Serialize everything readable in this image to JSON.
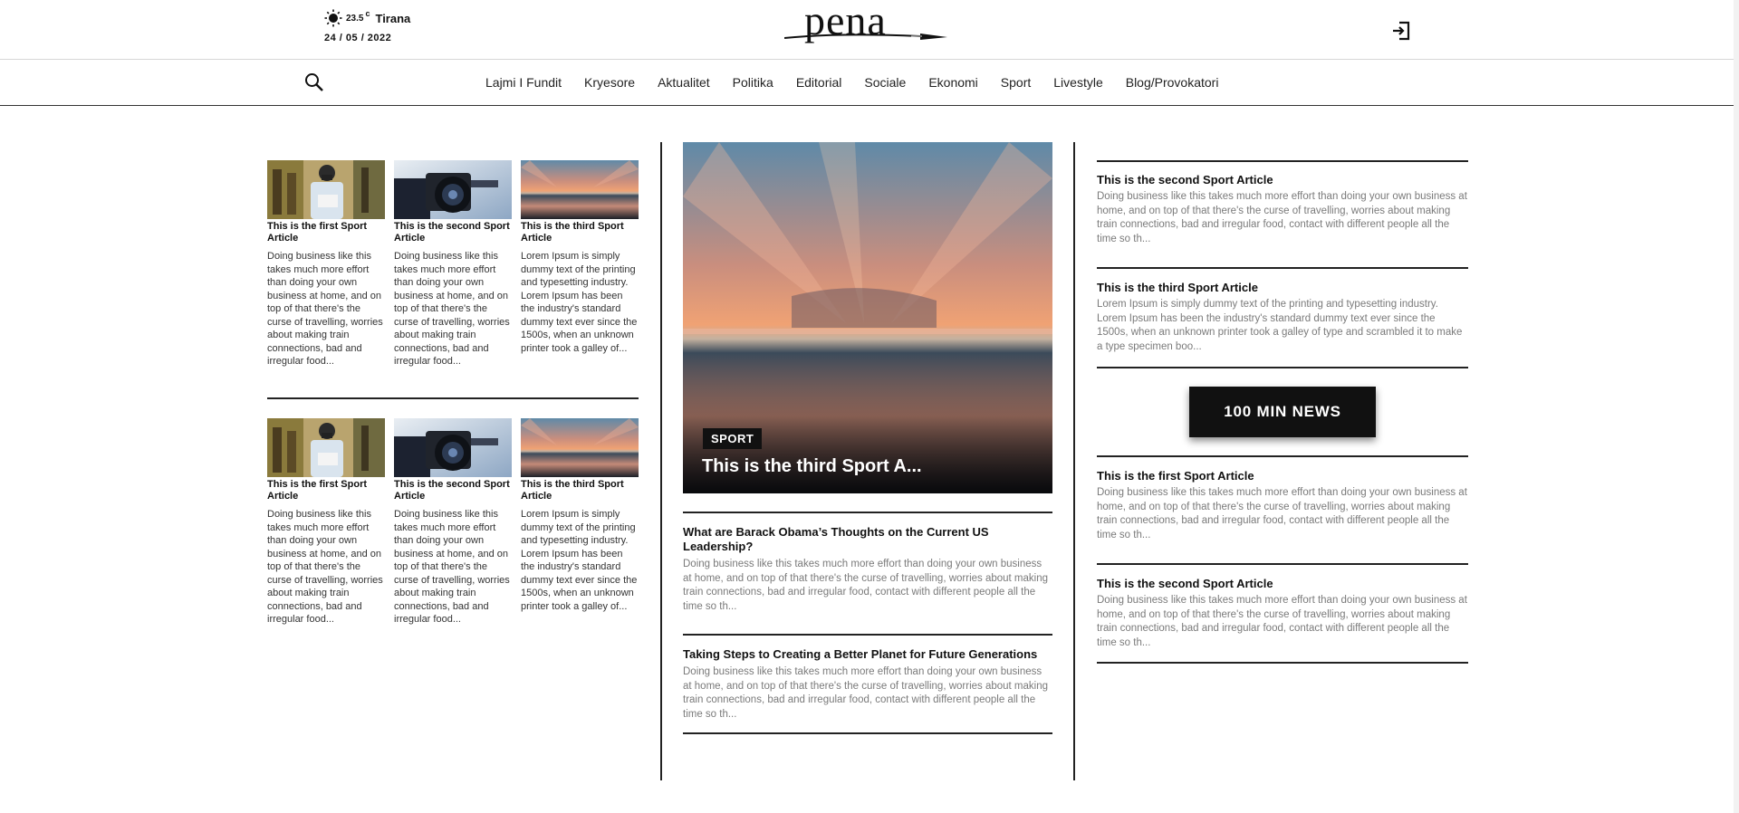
{
  "header": {
    "temperature": "23.5",
    "temp_unit": "c",
    "city": "Tirana",
    "date": "24 / 05 / 2022",
    "logo_text": "pena",
    "login_icon": "login-icon"
  },
  "nav": {
    "search_icon": "search-icon",
    "items": [
      {
        "label": "Lajmi I Fundit"
      },
      {
        "label": "Kryesore"
      },
      {
        "label": "Aktualitet"
      },
      {
        "label": "Politika"
      },
      {
        "label": "Editorial"
      },
      {
        "label": "Sociale"
      },
      {
        "label": "Ekonomi"
      },
      {
        "label": "Sport"
      },
      {
        "label": "Livestyle"
      },
      {
        "label": "Blog/Provokatori"
      }
    ]
  },
  "left_grid": {
    "row1": [
      {
        "title": "This is the first Sport Article",
        "excerpt": "Doing business like this takes much more effort than doing your own business at home, and on top of that there's the curse of travelling, worries about making train connections, bad and irregular food...",
        "image": "person-with-mask"
      },
      {
        "title": "This is the second Sport Article",
        "excerpt": "Doing business like this takes much more effort than doing your own business at home, and on top of that there's the curse of travelling, worries about making train connections, bad and irregular food...",
        "image": "video-camera"
      },
      {
        "title": "This is the third Sport Article",
        "excerpt": "Lorem Ipsum is simply dummy text of the printing and typesetting industry. Lorem Ipsum has been the industry's standard dummy text ever since the 1500s, when an unknown printer took a galley of...",
        "image": "sunset-sea"
      }
    ],
    "row2": [
      {
        "title": "This is the first Sport Article",
        "excerpt": "Doing business like this takes much more effort than doing your own business at home, and on top of that there's the curse of travelling, worries about making train connections, bad and irregular food...",
        "image": "person-with-mask"
      },
      {
        "title": "This is the second Sport Article",
        "excerpt": "Doing business like this takes much more effort than doing your own business at home, and on top of that there's the curse of travelling, worries about making train connections, bad and irregular food...",
        "image": "video-camera"
      },
      {
        "title": "This is the third Sport Article",
        "excerpt": "Lorem Ipsum is simply dummy text of the printing and typesetting industry. Lorem Ipsum has been the industry's standard dummy text ever since the 1500s, when an unknown printer took a galley of...",
        "image": "sunset-sea"
      }
    ]
  },
  "hero": {
    "tag": "SPORT",
    "title": "This is the third Sport A...",
    "image": "sunset-sea"
  },
  "middle_articles": [
    {
      "title": "What are Barack Obama’s Thoughts on the Current US Leadership?",
      "excerpt": "Doing business like this takes much more effort than doing your own business at home, and on top of that there's the curse of travelling, worries about making train connections, bad and irregular food, contact with different people all the time so th..."
    },
    {
      "title": "Taking Steps to Creating a Better Planet for Future Generations",
      "excerpt": "Doing business like this takes much more effort than doing your own business at home, and on top of that there's the curse of travelling, worries about making train connections, bad and irregular food, contact with different people all the time so th..."
    }
  ],
  "right_column": {
    "articles_top": [
      {
        "title": "This is the second Sport Article",
        "excerpt": "Doing business like this takes much more effort than doing your own business at home, and on top of that there's the curse of travelling, worries about making train connections, bad and irregular food, contact with different people all the time so th..."
      },
      {
        "title": "This is the third Sport Article",
        "excerpt": "Lorem Ipsum is simply dummy text of the printing and typesetting industry. Lorem Ipsum has been the industry's standard dummy text ever since the 1500s, when an unknown printer took a galley of type and scrambled it to make a type specimen boo..."
      }
    ],
    "button_label": "100 MIN NEWS",
    "articles_bottom": [
      {
        "title": "This is the first Sport Article",
        "excerpt": "Doing business like this takes much more effort than doing your own business at home, and on top of that there's the curse of travelling, worries about making train connections, bad and irregular food, contact with different people all the time so th..."
      },
      {
        "title": "This is the second Sport Article",
        "excerpt": "Doing business like this takes much more effort than doing your own business at home, and on top of that there's the curse of travelling, worries about making train connections, bad and irregular food, contact with different people all the time so th..."
      }
    ]
  },
  "colors": {
    "text": "#111111",
    "muted": "#7a7a7a",
    "button_bg": "#111111",
    "divider": "#222222"
  }
}
